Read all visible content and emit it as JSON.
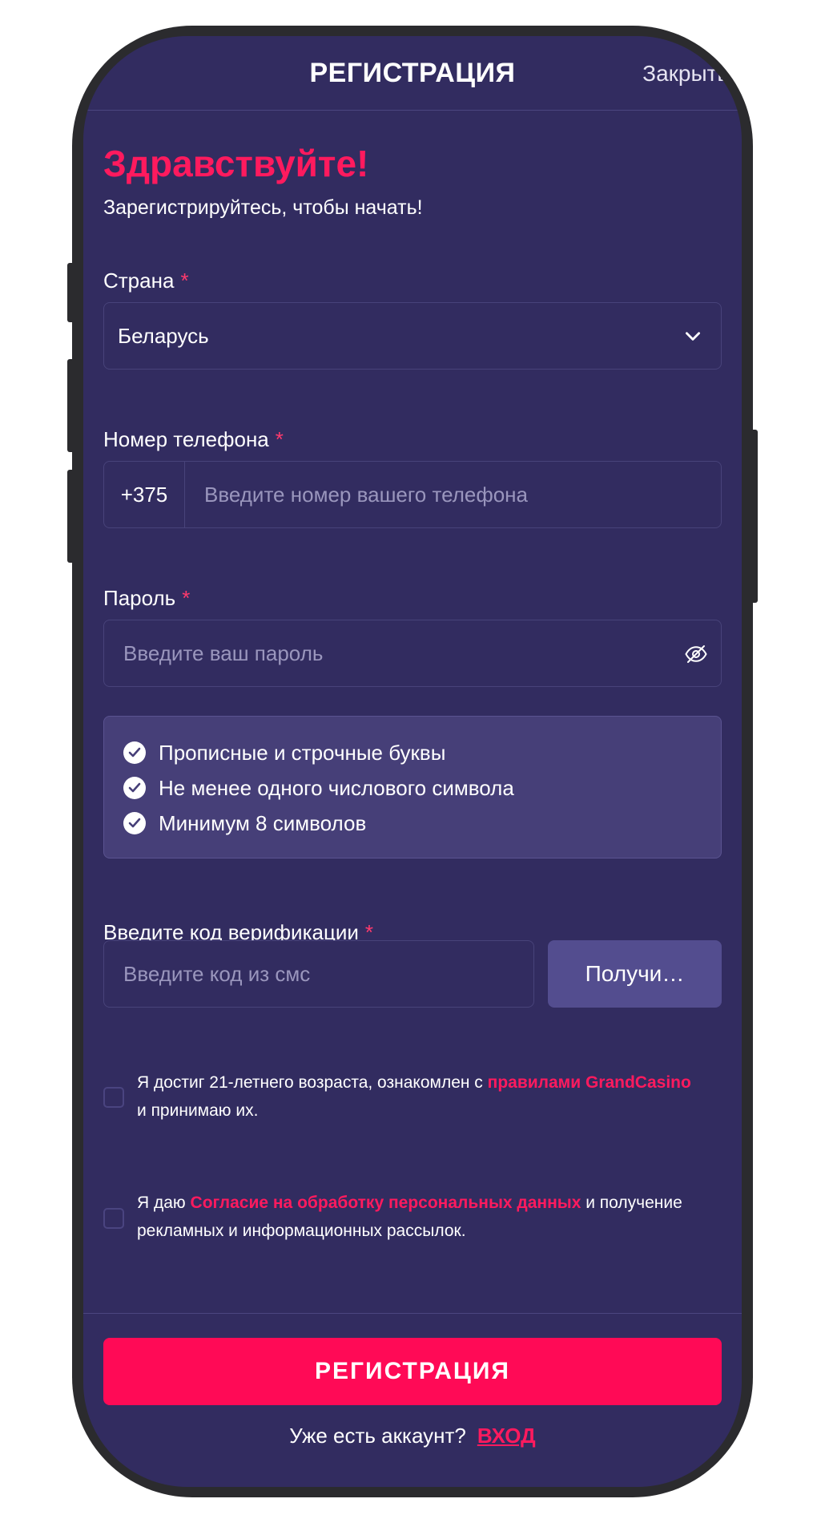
{
  "header": {
    "title": "РЕГИСТРАЦИЯ",
    "close_label": "Закрыть"
  },
  "intro": {
    "greeting": "Здравствуйте!",
    "subtitle": "Зарегистрируйтесь, чтобы начать!"
  },
  "country": {
    "label": "Страна",
    "required_mark": "*",
    "value": "Беларусь"
  },
  "phone": {
    "label": "Номер телефона",
    "required_mark": "*",
    "prefix": "+375",
    "placeholder": "Введите номер вашего телефона"
  },
  "password": {
    "label": "Пароль",
    "required_mark": "*",
    "placeholder": "Введите ваш пароль",
    "rules": [
      "Прописные и строчные буквы",
      "Не менее одного числового символа",
      "Минимум 8 символов"
    ]
  },
  "verification": {
    "label": "Введите код верификации",
    "required_mark": "*",
    "placeholder": "Введите код из смс",
    "button_label": "Получи…"
  },
  "consents": {
    "age": {
      "text_before": "Я достиг 21-летнего возраста, ознакомлен с ",
      "link": "правилами GrandCasino",
      "text_after": " и принимаю их."
    },
    "personal_data": {
      "text_before": "Я даю ",
      "link": "Согласие на обработку персональных данных",
      "text_after": " и получение рекламных и информационных рассылок."
    }
  },
  "footer": {
    "submit_label": "РЕГИСТРАЦИЯ",
    "account_question": "Уже есть аккаунт?",
    "login_label": "ВХОД"
  },
  "colors": {
    "background": "#322c60",
    "accent": "#ff0a56",
    "rules_box": "#463f78",
    "secondary_button": "#534d8f"
  },
  "icons": {
    "dropdown": "chevron-down-icon",
    "password_visibility": "eye-off-icon",
    "rule_status": "check-circle-icon"
  }
}
